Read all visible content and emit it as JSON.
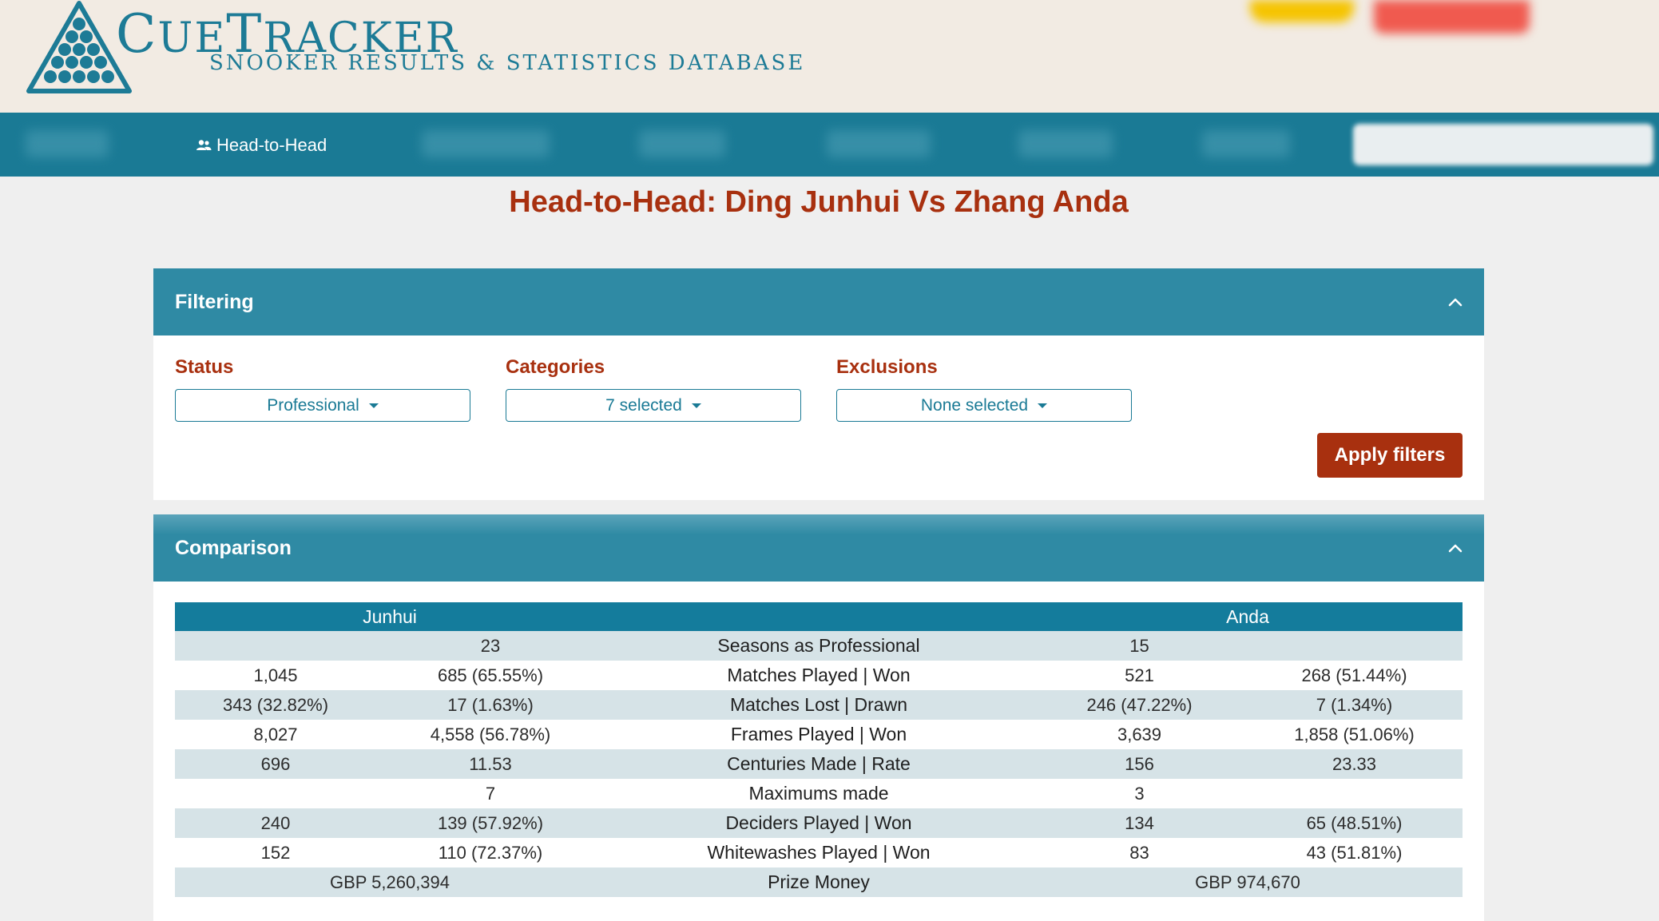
{
  "header": {
    "logo_title_first": "C",
    "logo_title_rest": "UE",
    "logo_title_second": "T",
    "logo_title_rest2": "RACKER",
    "logo_subtitle": "SNOOKER RESULTS & STATISTICS DATABASE"
  },
  "nav": {
    "active_item": "Head-to-Head",
    "active_icon": "people-icon"
  },
  "page": {
    "title": "Head-to-Head: Ding Junhui Vs Zhang Anda"
  },
  "filtering": {
    "title": "Filtering",
    "status_label": "Status",
    "status_value": "Professional",
    "categories_label": "Categories",
    "categories_value": "7 selected",
    "exclusions_label": "Exclusions",
    "exclusions_value": "None selected",
    "apply_label": "Apply filters"
  },
  "comparison": {
    "title": "Comparison",
    "player1": "Junhui",
    "player2": "Anda",
    "rows": [
      {
        "p1a": "",
        "p1b": "23",
        "label": "Seasons as Professional",
        "p2a": "15",
        "p2b": ""
      },
      {
        "p1a": "1,045",
        "p1b": "685 (65.55%)",
        "label": "Matches Played | Won",
        "p2a": "521",
        "p2b": "268 (51.44%)"
      },
      {
        "p1a": "343 (32.82%)",
        "p1b": "17 (1.63%)",
        "label": "Matches Lost | Drawn",
        "p2a": "246 (47.22%)",
        "p2b": "7 (1.34%)"
      },
      {
        "p1a": "8,027",
        "p1b": "4,558 (56.78%)",
        "label": "Frames Played | Won",
        "p2a": "3,639",
        "p2b": "1,858 (51.06%)"
      },
      {
        "p1a": "696",
        "p1b": "11.53",
        "label": "Centuries Made | Rate",
        "p2a": "156",
        "p2b": "23.33"
      },
      {
        "p1a": "",
        "p1b": "7",
        "label": "Maximums made",
        "p2a": "3",
        "p2b": ""
      },
      {
        "p1a": "240",
        "p1b": "139 (57.92%)",
        "label": "Deciders Played | Won",
        "p2a": "134",
        "p2b": "65 (48.51%)"
      },
      {
        "p1a": "152",
        "p1b": "110 (72.37%)",
        "label": "Whitewashes Played | Won",
        "p2a": "83",
        "p2b": "43 (51.81%)"
      }
    ],
    "prize_label": "Prize Money",
    "prize_p1": "GBP 5,260,394",
    "prize_p2": "GBP 974,670"
  },
  "colors": {
    "brand_teal": "#1a7a95",
    "panel_head": "#2f8aa4",
    "accent_red": "#a8300f"
  }
}
